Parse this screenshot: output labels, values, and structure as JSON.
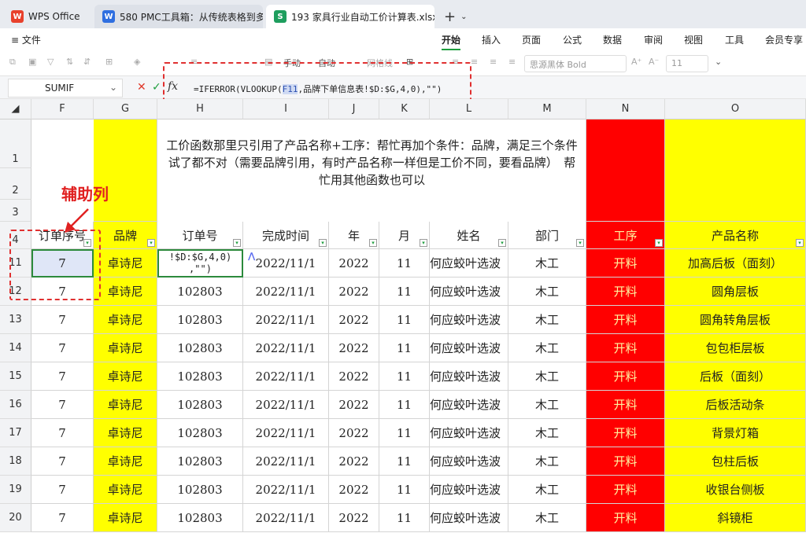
{
  "tabs": [
    {
      "label": "WPS Office",
      "icon": "wps-logo-icon"
    },
    {
      "label": "580 PMC工具箱：从传统表格到多",
      "icon": "wps-writer-icon"
    },
    {
      "label": "193 家具行业自动工价计算表.xlsx",
      "icon": "wps-sheet-icon",
      "close": "×"
    }
  ],
  "new_tab": "+",
  "file_menu": "≡ 文件",
  "ribbon_tabs": [
    "开始",
    "插入",
    "页面",
    "公式",
    "数据",
    "审阅",
    "视图",
    "工具",
    "会员专享"
  ],
  "toolbar": {
    "manual_label": "手动",
    "auto_label": "自动",
    "gridlines_label": "网格线",
    "font_name": "思源黑体 Bold",
    "font_size": "11"
  },
  "formula_bar": {
    "name_box": "SUMIF",
    "cancel": "✕",
    "confirm": "✓",
    "fx": "fx",
    "formula_pre": "=IFERROR(VLOOKUP(",
    "formula_ref": "F11",
    "formula_post": ",品牌下单信息表!$D:$G,4,0),\"\")"
  },
  "columns": [
    "F",
    "G",
    "H",
    "I",
    "J",
    "K",
    "L",
    "M",
    "N",
    "O"
  ],
  "title_text": "工价函数那里只引用了产品名称+工序：帮忙再加个条件：品牌，满足三个条件试了都不对（需要品牌引用，有时产品名称一样但是工价不同，要看品牌）　帮忙用其他函数也可以",
  "annotation": "辅助列",
  "headers": [
    "订单序号",
    "品牌",
    "订单号",
    "完成时间",
    "年",
    "月",
    "姓名",
    "部门",
    "工序",
    "产品名称"
  ],
  "editing_cell_text": "!$D:$G,4,0)\n,\"\")",
  "rows": [
    {
      "num": "11",
      "cells": [
        "7",
        "卓诗尼",
        "",
        "2022/11/1",
        "2022",
        "11",
        "何应蛟叶选波",
        "木工",
        "开料",
        "加高后板（面刻）"
      ]
    },
    {
      "num": "12",
      "cells": [
        "7",
        "卓诗尼",
        "102803",
        "2022/11/1",
        "2022",
        "11",
        "何应蛟叶选波",
        "木工",
        "开料",
        "圆角层板"
      ]
    },
    {
      "num": "13",
      "cells": [
        "7",
        "卓诗尼",
        "102803",
        "2022/11/1",
        "2022",
        "11",
        "何应蛟叶选波",
        "木工",
        "开料",
        "圆角转角层板"
      ]
    },
    {
      "num": "14",
      "cells": [
        "7",
        "卓诗尼",
        "102803",
        "2022/11/1",
        "2022",
        "11",
        "何应蛟叶选波",
        "木工",
        "开料",
        "包包柜层板"
      ]
    },
    {
      "num": "15",
      "cells": [
        "7",
        "卓诗尼",
        "102803",
        "2022/11/1",
        "2022",
        "11",
        "何应蛟叶选波",
        "木工",
        "开料",
        "后板（面刻）"
      ]
    },
    {
      "num": "16",
      "cells": [
        "7",
        "卓诗尼",
        "102803",
        "2022/11/1",
        "2022",
        "11",
        "何应蛟叶选波",
        "木工",
        "开料",
        "后板活动条"
      ]
    },
    {
      "num": "17",
      "cells": [
        "7",
        "卓诗尼",
        "102803",
        "2022/11/1",
        "2022",
        "11",
        "何应蛟叶选波",
        "木工",
        "开料",
        "背景灯箱"
      ]
    },
    {
      "num": "18",
      "cells": [
        "7",
        "卓诗尼",
        "102803",
        "2022/11/1",
        "2022",
        "11",
        "何应蛟叶选波",
        "木工",
        "开料",
        "包柱后板"
      ]
    },
    {
      "num": "19",
      "cells": [
        "7",
        "卓诗尼",
        "102803",
        "2022/11/1",
        "2022",
        "11",
        "何应蛟叶选波",
        "木工",
        "开料",
        "收银台侧板"
      ]
    },
    {
      "num": "20",
      "cells": [
        "7",
        "卓诗尼",
        "102803",
        "2022/11/1",
        "2022",
        "11",
        "何应蛟叶选波",
        "木工",
        "开料",
        "斜镜柜"
      ]
    }
  ],
  "row_labels_top": [
    "1",
    "2",
    "3",
    "4"
  ],
  "colors": {
    "yellow": "#ffff00",
    "red": "#ff0000",
    "selected": "#dfe6f7",
    "annotation": "#e02020"
  }
}
